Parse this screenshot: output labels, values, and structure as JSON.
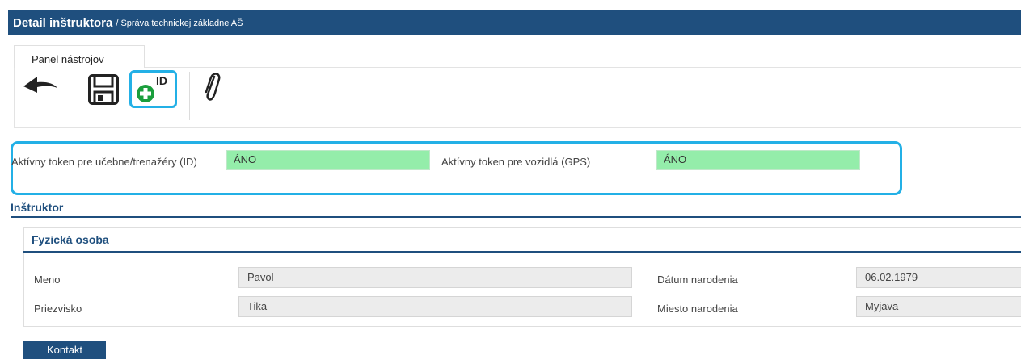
{
  "header": {
    "title": "Detail inštruktora",
    "separator": "/",
    "subtitle": "Správa technickej základne AŠ"
  },
  "toolbar": {
    "tab_label": "Panel nástrojov",
    "id_badge": "ID",
    "icons": [
      "back-arrow-icon",
      "save-icon",
      "add-id-icon",
      "attachment-icon"
    ]
  },
  "tokens": {
    "classroom_label": "Aktívny token pre učebne/trenažéry (ID)",
    "classroom_value": "ÁNO",
    "vehicle_label": "Aktívny token pre vozidlá (GPS)",
    "vehicle_value": "ÁNO"
  },
  "instructor": {
    "section_title": "Inštruktor",
    "person_title": "Fyzická osoba",
    "first_name_label": "Meno",
    "first_name_value": "Pavol",
    "last_name_label": "Priezvisko",
    "last_name_value": "Tika",
    "birth_date_label": "Dátum narodenia",
    "birth_date_value": "06.02.1979",
    "birth_place_label": "Miesto narodenia",
    "birth_place_value": "Myjava"
  },
  "contact_button": "Kontakt",
  "colors": {
    "header": "#1f4f7e",
    "highlight": "#23b0e6",
    "active_field": "#94edaa",
    "readonly_field": "#ececec",
    "add_icon": "#1a9e3c"
  }
}
